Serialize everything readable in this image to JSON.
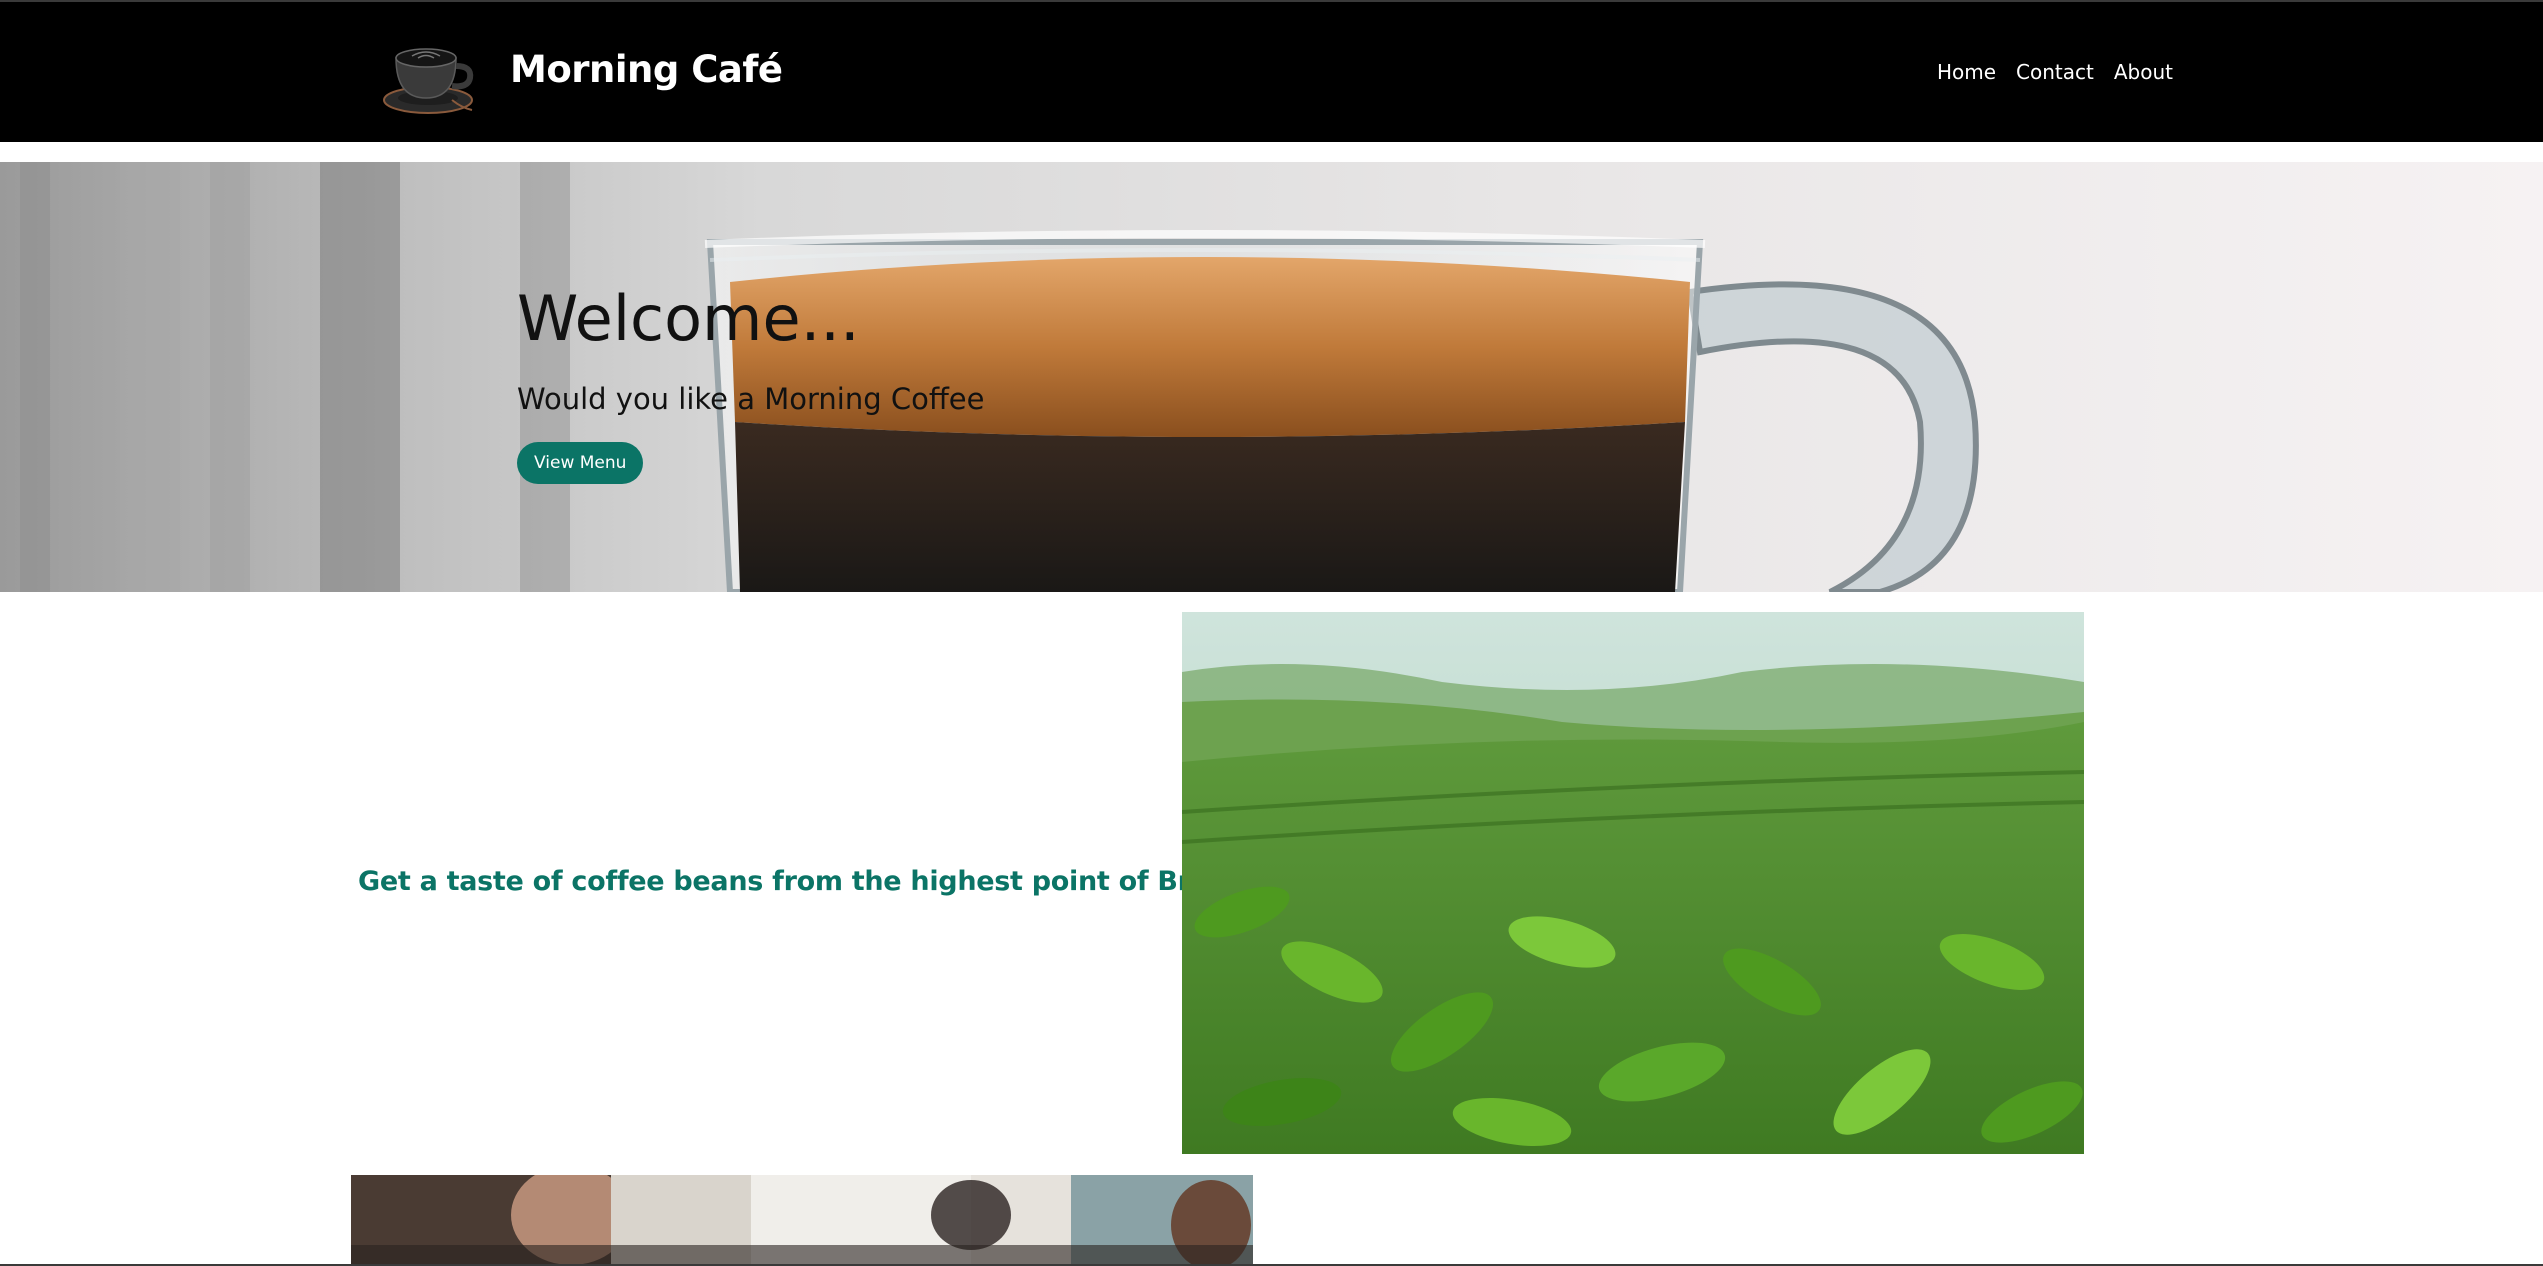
{
  "header": {
    "logo_icon": "coffee-cup-icon",
    "brand_title": "Morning Café",
    "nav": [
      {
        "label": "Home"
      },
      {
        "label": "Contact"
      },
      {
        "label": "About"
      }
    ]
  },
  "hero": {
    "title": "Welcome...",
    "subtitle": "Would you like a Morning Coffee",
    "button_label": "View Menu",
    "background_image": "espresso-glass-cup"
  },
  "feature": {
    "text": "Get a taste of coffee beans from the highest point of Brazil.",
    "image": "coffee-plantation"
  },
  "gallery": {
    "image": "barista-at-work"
  },
  "colors": {
    "header_bg": "#000000",
    "accent": "#0b7466",
    "text_dark": "#111111",
    "white": "#ffffff"
  }
}
